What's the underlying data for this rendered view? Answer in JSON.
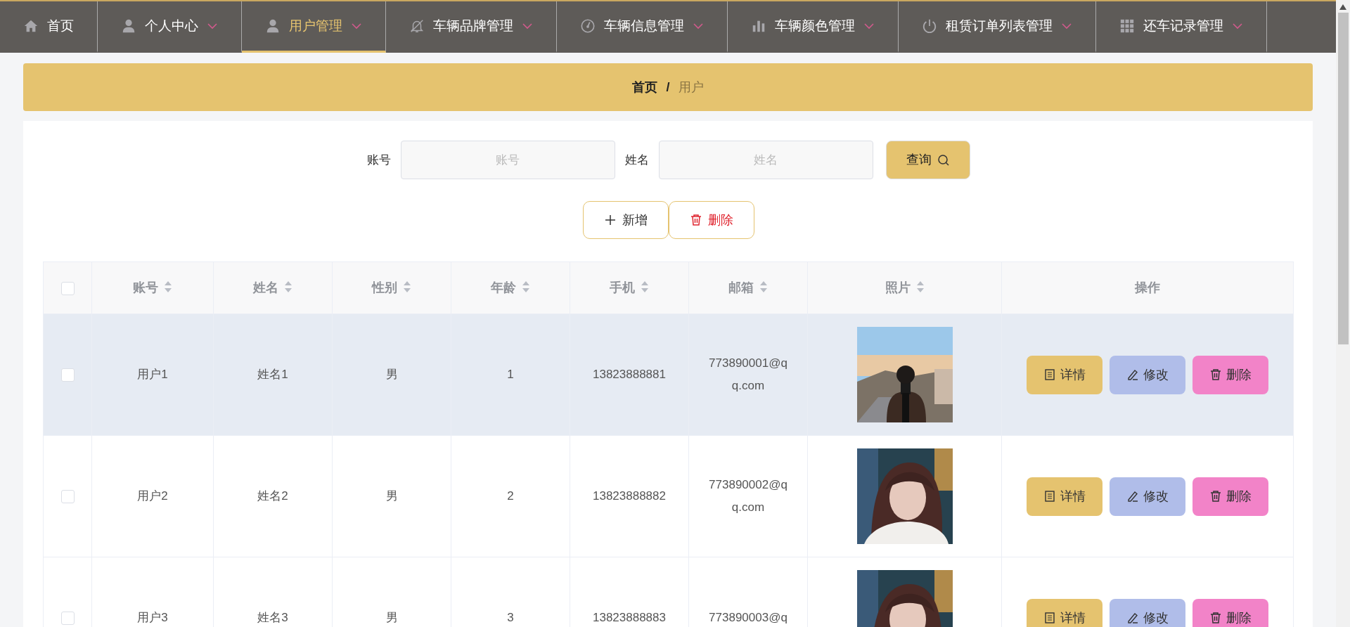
{
  "nav": {
    "items": [
      {
        "label": "首页",
        "selected": false,
        "has_menu": false
      },
      {
        "label": "个人中心",
        "selected": false,
        "has_menu": true
      },
      {
        "label": "用户管理",
        "selected": true,
        "has_menu": true
      },
      {
        "label": "车辆品牌管理",
        "selected": false,
        "has_menu": true
      },
      {
        "label": "车辆信息管理",
        "selected": false,
        "has_menu": true
      },
      {
        "label": "车辆颜色管理",
        "selected": false,
        "has_menu": true
      },
      {
        "label": "租赁订单列表管理",
        "selected": false,
        "has_menu": true
      },
      {
        "label": "还车记录管理",
        "selected": false,
        "has_menu": true
      }
    ]
  },
  "breadcrumb": {
    "items": [
      "首页",
      "用户"
    ],
    "separator": "/"
  },
  "search": {
    "fields": [
      {
        "label": "账号",
        "placeholder": "账号"
      },
      {
        "label": "姓名",
        "placeholder": "姓名"
      }
    ],
    "button": "查询"
  },
  "actions": [
    {
      "label": "新增",
      "kind": "add"
    },
    {
      "label": "删除",
      "kind": "delete"
    }
  ],
  "table": {
    "header_checked": false,
    "columns": [
      {
        "label": "账号",
        "sortable": true
      },
      {
        "label": "姓名",
        "sortable": true
      },
      {
        "label": "性别",
        "sortable": true
      },
      {
        "label": "年龄",
        "sortable": true
      },
      {
        "label": "手机",
        "sortable": true
      },
      {
        "label": "邮箱",
        "sortable": true
      },
      {
        "label": "照片",
        "sortable": true
      },
      {
        "label": "操作",
        "sortable": false
      }
    ],
    "rows": [
      {
        "checked": false,
        "highlighted": true,
        "cells": [
          "用户1",
          "姓名1",
          "男",
          "1",
          "13823888881",
          "773890001@qq.com"
        ],
        "buttons": [
          {
            "label": "详情",
            "kind": "detail"
          },
          {
            "label": "修改",
            "kind": "edit"
          },
          {
            "label": "删除",
            "kind": "delete"
          }
        ]
      },
      {
        "checked": false,
        "highlighted": false,
        "cells": [
          "用户2",
          "姓名2",
          "男",
          "2",
          "13823888882",
          "773890002@qq.com"
        ],
        "buttons": [
          {
            "label": "详情",
            "kind": "detail"
          },
          {
            "label": "修改",
            "kind": "edit"
          },
          {
            "label": "删除",
            "kind": "delete"
          }
        ]
      },
      {
        "checked": false,
        "highlighted": false,
        "cells": [
          "用户3",
          "姓名3",
          "男",
          "3",
          "13823888883",
          "773890003@q"
        ],
        "buttons": [
          {
            "label": "详情",
            "kind": "detail"
          },
          {
            "label": "修改",
            "kind": "edit"
          },
          {
            "label": "删除",
            "kind": "delete"
          }
        ]
      }
    ]
  }
}
